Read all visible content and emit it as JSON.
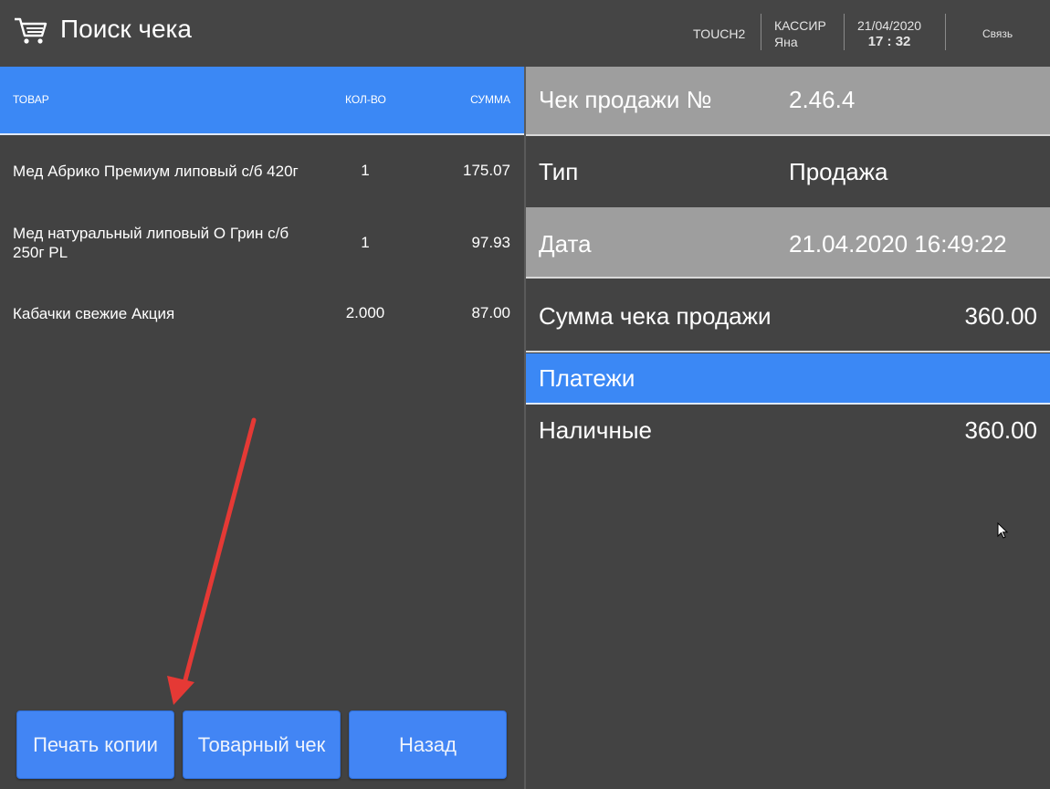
{
  "header": {
    "title": "Поиск чека",
    "terminal": "TOUCH2",
    "cashier_label": "КАССИР",
    "cashier_name": "Яна",
    "date": "21/04/2020",
    "time": "17 : 32",
    "connection": "Связь"
  },
  "items_table": {
    "columns": {
      "item": "ТОВАР",
      "qty": "КОЛ-ВО",
      "sum": "СУММА"
    },
    "rows": [
      {
        "name": "Мед Абрико Премиум липовый с/б 420г",
        "qty": "1",
        "sum": "175.07"
      },
      {
        "name": "Мед натуральный липовый О Грин с/б 250г PL",
        "qty": "1",
        "sum": "97.93"
      },
      {
        "name": "Кабачки свежие Акция",
        "qty": "2.000",
        "sum": "87.00"
      }
    ]
  },
  "buttons": {
    "print_copy": "Печать копии",
    "sales_receipt": "Товарный чек",
    "back": "Назад"
  },
  "receipt": {
    "number_label": "Чек продажи №",
    "number_value": "2.46.4",
    "type_label": "Тип",
    "type_value": "Продажа",
    "date_label": "Дата",
    "date_value": "21.04.2020 16:49:22",
    "total_label": "Сумма чека продажи",
    "total_value": "360.00",
    "payments_header": "Платежи",
    "payment_method": "Наличные",
    "payment_amount": "360.00"
  },
  "colors": {
    "accent_blue": "#3b88f5",
    "panel_dark": "#424242",
    "row_gray": "#9e9e9e",
    "annotation_red": "#e53935"
  }
}
